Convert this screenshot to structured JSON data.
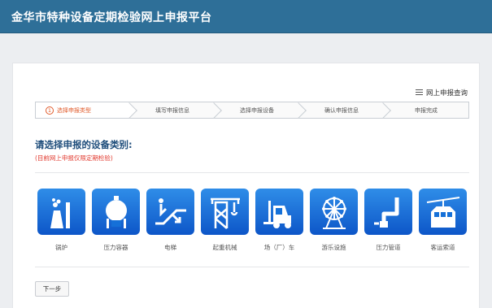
{
  "header": {
    "title": "金华市特种设备定期检验网上申报平台"
  },
  "query_link": "网上申报查询",
  "steps": [
    {
      "num": "1",
      "label": "选择申报类型"
    },
    {
      "label": "填写申报信息"
    },
    {
      "label": "选择申报设备"
    },
    {
      "label": "确认申报信息"
    },
    {
      "label": "申报完成"
    }
  ],
  "heading": "请选择申报的设备类别:",
  "note": "(目前网上申报仅限定期检验)",
  "devices": [
    {
      "label": "锅炉",
      "icon": "boiler-icon"
    },
    {
      "label": "压力容器",
      "icon": "pressure-vessel-icon"
    },
    {
      "label": "电梯",
      "icon": "escalator-icon"
    },
    {
      "label": "起重机械",
      "icon": "crane-icon"
    },
    {
      "label": "场（厂）车",
      "icon": "forklift-icon"
    },
    {
      "label": "游乐设施",
      "icon": "ferris-wheel-icon"
    },
    {
      "label": "压力管道",
      "icon": "pipeline-icon"
    },
    {
      "label": "客运索道",
      "icon": "cable-car-icon"
    }
  ],
  "next_button": "下一步",
  "colors": {
    "header": "#2e6f98",
    "tile": "#1570d8",
    "active_step": "#e05a2a",
    "note": "#e23b30",
    "heading": "#1e4d7b"
  }
}
